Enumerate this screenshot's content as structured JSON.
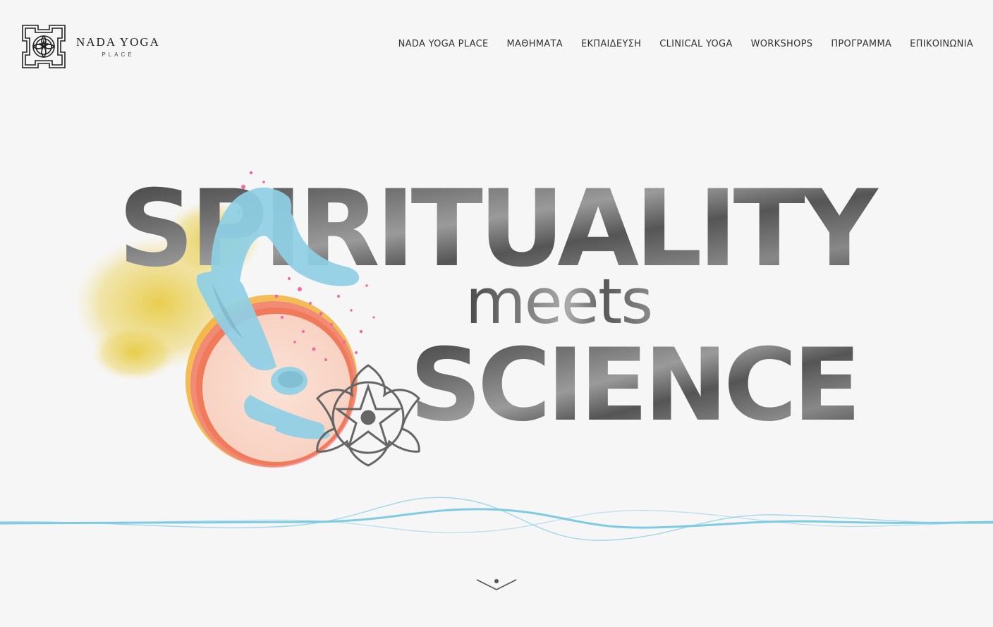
{
  "brand": {
    "title": "NADA YOGA",
    "subtitle": "PLACE"
  },
  "nav": [
    {
      "label": "NADA YOGA PLACE"
    },
    {
      "label": "ΜΑΘΗΜΑΤΑ"
    },
    {
      "label": "ΕΚΠΑΙΔΕΥΣΗ"
    },
    {
      "label": "CLINICAL YOGA"
    },
    {
      "label": "WORKSHOPS"
    },
    {
      "label": "ΠΡΟΓΡΑΜΜΑ"
    },
    {
      "label": "ΕΠΙΚΟΙΝΩΝΙΑ"
    }
  ],
  "hero": {
    "line1": "SPIRITUALITY",
    "line2": "meets",
    "line3": "SCIENCE"
  },
  "icons": {
    "logo": "yantra-lotus-icon",
    "emblem": "lotus-star-icon",
    "scroll": "chevron-down-icon"
  },
  "colors": {
    "background": "#f6f6f6",
    "text_dark": "#3a3a3a",
    "wave": "#7fcbe3",
    "figure": "#8fd0e6",
    "splash_yellow": "#e8cf4a",
    "splash_pink": "#f06aa0",
    "circle_orange": "#f07a5a"
  }
}
